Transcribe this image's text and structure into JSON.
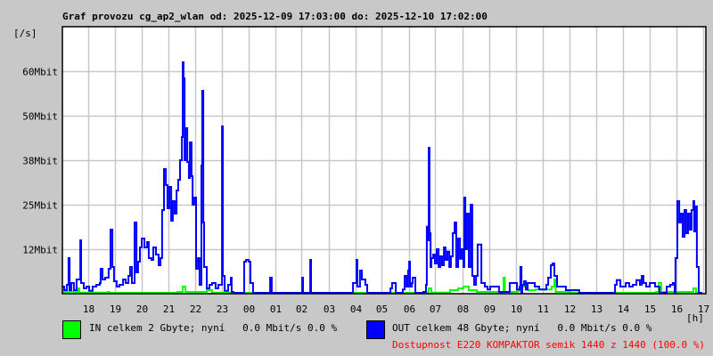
{
  "title": "Graf provozu cg_ap2_wlan od: 2025-12-09 17:03:00 do: 2025-12-10 17:02:00",
  "legend": {
    "in": {
      "label": "IN celkem 2 Gbyte; nyní   0.0 Mbit/s 0.0 %",
      "color": "#00ff00"
    },
    "out": {
      "label": "OUT celkem 48 Gbyte; nyní   0.0 Mbit/s 0.0 %",
      "color": "#0000ff"
    },
    "availability": "Dostupnost E220 KOMPAKTOR semik 1440 z 1440 (100.0 %)",
    "availability_color": "#ff0000"
  },
  "chart_data": {
    "type": "line",
    "title": "Graf provozu cg_ap2_wlan od: 2025-12-09 17:03:00 do: 2025-12-10 17:02:00",
    "ylabel": "[/s]",
    "xlabel": "[h]",
    "x_units": "hours since 17:03",
    "ylim": [
      0,
      75
    ],
    "xlim": [
      0,
      24
    ],
    "grid": true,
    "y_ticks": [
      {
        "value": 12.5,
        "label": "12Mbit"
      },
      {
        "value": 25,
        "label": "25Mbit"
      },
      {
        "value": 37.5,
        "label": "38Mbit"
      },
      {
        "value": 50,
        "label": "50Mbit"
      },
      {
        "value": 62.5,
        "label": "60Mbit"
      }
    ],
    "x_first_tick": 0.95,
    "x_tick_labels": [
      "18",
      "19",
      "20",
      "21",
      "22",
      "23",
      "00",
      "01",
      "02",
      "03",
      "04",
      "05",
      "06",
      "07",
      "08",
      "09",
      "10",
      "11",
      "12",
      "13",
      "14",
      "15",
      "16",
      "17"
    ],
    "series": [
      {
        "name": "IN",
        "color": "#00ff00",
        "points": [
          [
            0,
            0.5
          ],
          [
            0.6,
            1.5
          ],
          [
            0.63,
            0.3
          ],
          [
            1.0,
            0.3
          ],
          [
            1.7,
            0.5
          ],
          [
            1.75,
            0.1
          ],
          [
            3.5,
            0.2
          ],
          [
            4.3,
            0.5
          ],
          [
            4.5,
            2
          ],
          [
            4.6,
            0.5
          ],
          [
            5.2,
            0.5
          ],
          [
            5.4,
            1
          ],
          [
            5.6,
            0.3
          ],
          [
            6,
            0
          ],
          [
            13.5,
            0
          ],
          [
            13.6,
            0.3
          ],
          [
            13.7,
            1.5
          ],
          [
            13.8,
            0.3
          ],
          [
            14.5,
            1
          ],
          [
            14.8,
            1.5
          ],
          [
            15.0,
            2
          ],
          [
            15.2,
            1
          ],
          [
            15.5,
            0.5
          ],
          [
            16.4,
            0.3
          ],
          [
            16.5,
            4.5
          ],
          [
            16.55,
            0.5
          ],
          [
            17.0,
            0.7
          ],
          [
            17.1,
            2
          ],
          [
            17.4,
            1
          ],
          [
            17.7,
            1.2
          ],
          [
            18.3,
            2
          ],
          [
            18.4,
            4
          ],
          [
            18.45,
            0.5
          ],
          [
            19.0,
            0.3
          ],
          [
            19.3,
            0
          ],
          [
            22.1,
            0
          ],
          [
            22.2,
            0.5
          ],
          [
            22.3,
            3
          ],
          [
            22.4,
            0.5
          ],
          [
            23.5,
            0.5
          ],
          [
            23.6,
            1.5
          ],
          [
            23.7,
            0.3
          ],
          [
            23.9,
            0
          ]
        ]
      },
      {
        "name": "OUT",
        "color": "#0000ff",
        "points": [
          [
            0,
            2
          ],
          [
            0.07,
            1
          ],
          [
            0.17,
            2.5
          ],
          [
            0.23,
            10
          ],
          [
            0.27,
            1
          ],
          [
            0.33,
            3
          ],
          [
            0.43,
            1
          ],
          [
            0.53,
            4
          ],
          [
            0.6,
            4
          ],
          [
            0.67,
            15
          ],
          [
            0.7,
            3
          ],
          [
            0.8,
            1.5
          ],
          [
            0.9,
            2
          ],
          [
            1.0,
            0.8
          ],
          [
            1.13,
            2
          ],
          [
            1.27,
            2.5
          ],
          [
            1.4,
            3
          ],
          [
            1.43,
            7
          ],
          [
            1.5,
            4
          ],
          [
            1.6,
            4.5
          ],
          [
            1.73,
            7
          ],
          [
            1.8,
            18
          ],
          [
            1.87,
            7.5
          ],
          [
            1.93,
            3.5
          ],
          [
            2.03,
            2
          ],
          [
            2.13,
            2.5
          ],
          [
            2.27,
            4
          ],
          [
            2.37,
            3
          ],
          [
            2.47,
            5
          ],
          [
            2.53,
            7.5
          ],
          [
            2.6,
            3
          ],
          [
            2.7,
            20
          ],
          [
            2.77,
            6
          ],
          [
            2.83,
            9
          ],
          [
            2.9,
            13
          ],
          [
            2.97,
            15.5
          ],
          [
            3.07,
            13
          ],
          [
            3.17,
            14.5
          ],
          [
            3.23,
            10
          ],
          [
            3.33,
            9.5
          ],
          [
            3.4,
            13
          ],
          [
            3.5,
            11
          ],
          [
            3.6,
            8
          ],
          [
            3.67,
            10
          ],
          [
            3.73,
            23.5
          ],
          [
            3.8,
            35
          ],
          [
            3.87,
            30.5
          ],
          [
            3.93,
            24
          ],
          [
            4.0,
            30
          ],
          [
            4.07,
            20.5
          ],
          [
            4.13,
            26
          ],
          [
            4.2,
            22.5
          ],
          [
            4.27,
            29
          ],
          [
            4.33,
            32
          ],
          [
            4.4,
            37.5
          ],
          [
            4.47,
            44
          ],
          [
            4.5,
            65
          ],
          [
            4.53,
            60.5
          ],
          [
            4.57,
            37.5
          ],
          [
            4.6,
            46.5
          ],
          [
            4.67,
            37
          ],
          [
            4.73,
            32.5
          ],
          [
            4.77,
            42.5
          ],
          [
            4.83,
            33
          ],
          [
            4.87,
            25
          ],
          [
            4.93,
            27
          ],
          [
            5.0,
            7
          ],
          [
            5.07,
            10
          ],
          [
            5.13,
            2.5
          ],
          [
            5.2,
            36
          ],
          [
            5.23,
            57
          ],
          [
            5.27,
            20
          ],
          [
            5.3,
            7.5
          ],
          [
            5.4,
            1.5
          ],
          [
            5.5,
            2.5
          ],
          [
            5.6,
            3
          ],
          [
            5.73,
            1.5
          ],
          [
            5.83,
            2.5
          ],
          [
            5.97,
            47
          ],
          [
            6.0,
            5
          ],
          [
            6.07,
            0.8
          ],
          [
            6.2,
            2.5
          ],
          [
            6.3,
            4.5
          ],
          [
            6.33,
            0.5
          ],
          [
            6.4,
            0
          ],
          [
            6.67,
            0
          ],
          [
            6.8,
            9
          ],
          [
            6.87,
            9.5
          ],
          [
            6.97,
            9
          ],
          [
            7.03,
            3
          ],
          [
            7.13,
            0
          ],
          [
            7.73,
            0
          ],
          [
            7.77,
            4.5
          ],
          [
            7.83,
            0
          ],
          [
            8.93,
            0
          ],
          [
            8.97,
            4.5
          ],
          [
            9.0,
            0
          ],
          [
            9.2,
            0
          ],
          [
            9.27,
            9.5
          ],
          [
            9.3,
            0
          ],
          [
            10.67,
            0
          ],
          [
            10.87,
            3
          ],
          [
            11.0,
            9.5
          ],
          [
            11.03,
            2
          ],
          [
            11.13,
            6.5
          ],
          [
            11.2,
            4
          ],
          [
            11.33,
            2.5
          ],
          [
            11.4,
            0
          ],
          [
            12.27,
            1.5
          ],
          [
            12.33,
            3
          ],
          [
            12.47,
            0
          ],
          [
            12.73,
            1.2
          ],
          [
            12.8,
            5
          ],
          [
            12.87,
            2
          ],
          [
            12.93,
            6.5
          ],
          [
            12.97,
            9
          ],
          [
            13.0,
            2
          ],
          [
            13.07,
            3
          ],
          [
            13.1,
            4.5
          ],
          [
            13.2,
            0
          ],
          [
            13.5,
            0.5
          ],
          [
            13.6,
            2.5
          ],
          [
            13.63,
            18.8
          ],
          [
            13.67,
            15
          ],
          [
            13.7,
            41
          ],
          [
            13.73,
            17
          ],
          [
            13.77,
            7.5
          ],
          [
            13.8,
            10
          ],
          [
            13.87,
            11
          ],
          [
            13.93,
            8.5
          ],
          [
            14.0,
            12.5
          ],
          [
            14.07,
            7.5
          ],
          [
            14.13,
            10.5
          ],
          [
            14.2,
            8
          ],
          [
            14.27,
            13
          ],
          [
            14.33,
            9.5
          ],
          [
            14.4,
            11.8
          ],
          [
            14.47,
            7.5
          ],
          [
            14.53,
            10.5
          ],
          [
            14.6,
            17
          ],
          [
            14.67,
            20
          ],
          [
            14.73,
            7.5
          ],
          [
            14.8,
            15.5
          ],
          [
            14.87,
            9.8
          ],
          [
            14.93,
            12.5
          ],
          [
            15.0,
            7.5
          ],
          [
            15.03,
            27
          ],
          [
            15.07,
            12.5
          ],
          [
            15.13,
            22.5
          ],
          [
            15.2,
            7.5
          ],
          [
            15.27,
            25
          ],
          [
            15.33,
            5
          ],
          [
            15.4,
            2.5
          ],
          [
            15.47,
            5
          ],
          [
            15.53,
            13.8
          ],
          [
            15.67,
            3
          ],
          [
            15.8,
            2
          ],
          [
            15.9,
            1.2
          ],
          [
            16.0,
            2
          ],
          [
            16.33,
            0.5
          ],
          [
            16.73,
            3
          ],
          [
            17.0,
            1.2
          ],
          [
            17.1,
            2
          ],
          [
            17.13,
            7.5
          ],
          [
            17.17,
            0
          ],
          [
            17.2,
            2.5
          ],
          [
            17.27,
            3.5
          ],
          [
            17.33,
            1.2
          ],
          [
            17.4,
            3
          ],
          [
            17.67,
            2
          ],
          [
            17.83,
            1.2
          ],
          [
            18.0,
            1.2
          ],
          [
            18.1,
            2.5
          ],
          [
            18.17,
            4.5
          ],
          [
            18.27,
            8
          ],
          [
            18.33,
            8.5
          ],
          [
            18.4,
            5
          ],
          [
            18.5,
            2
          ],
          [
            18.6,
            2
          ],
          [
            18.83,
            1
          ],
          [
            19.0,
            1
          ],
          [
            19.33,
            0
          ],
          [
            20.6,
            0
          ],
          [
            20.67,
            2.5
          ],
          [
            20.73,
            3.8
          ],
          [
            20.87,
            2
          ],
          [
            21.0,
            2
          ],
          [
            21.07,
            3
          ],
          [
            21.2,
            2
          ],
          [
            21.33,
            2.5
          ],
          [
            21.47,
            3.8
          ],
          [
            21.6,
            2.5
          ],
          [
            21.67,
            5
          ],
          [
            21.73,
            3
          ],
          [
            21.83,
            2
          ],
          [
            21.97,
            3
          ],
          [
            22.17,
            2
          ],
          [
            22.33,
            0
          ],
          [
            22.6,
            2
          ],
          [
            22.73,
            2.5
          ],
          [
            22.83,
            3
          ],
          [
            22.9,
            0
          ],
          [
            22.93,
            10
          ],
          [
            23.0,
            26
          ],
          [
            23.07,
            20
          ],
          [
            23.13,
            22.5
          ],
          [
            23.2,
            16
          ],
          [
            23.27,
            23.5
          ],
          [
            23.33,
            17
          ],
          [
            23.4,
            22.5
          ],
          [
            23.47,
            18
          ],
          [
            23.53,
            23.5
          ],
          [
            23.6,
            26
          ],
          [
            23.63,
            17.5
          ],
          [
            23.67,
            24.5
          ],
          [
            23.73,
            7.5
          ],
          [
            23.8,
            0
          ],
          [
            23.93,
            0
          ]
        ]
      }
    ]
  }
}
